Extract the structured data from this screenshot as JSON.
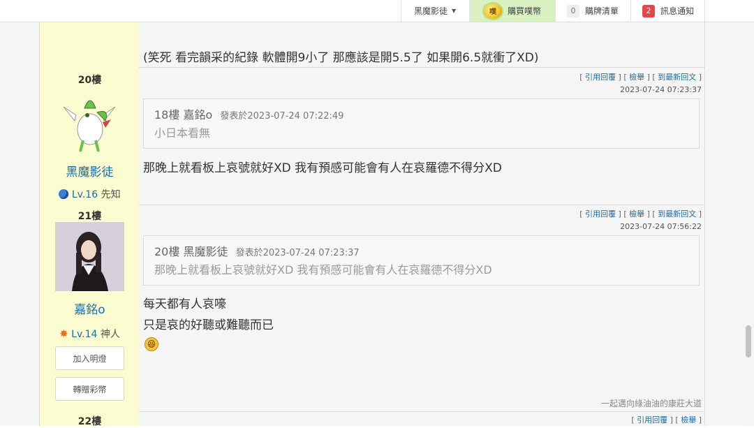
{
  "topbar": {
    "user_menu": "黑魔影徒",
    "buy_coins": "購買噗幣",
    "coin_icon_text": "噗",
    "cart_count": "0",
    "cart_label": "購牌清單",
    "notify_count": "2",
    "notify_label": "訊息通知"
  },
  "prev_post": {
    "text": "(笑死 看完韻采的紀錄 軟體開9小了 那應該是開5.5了 如果開6.5就衝了XD)"
  },
  "post20": {
    "floor": "20樓",
    "avatar_icon": "shaymin-sky-forme",
    "username": "黑魔影徒",
    "level": "Lv.16",
    "rank": "先知",
    "level_icon": "planet-icon",
    "actions": {
      "reply": "引用回覆",
      "report": "檢舉",
      "latest": "到最新回文"
    },
    "time": "2023-07-24 07:23:37",
    "quote": {
      "floor": "18樓",
      "user": "嘉銘o",
      "meta": "發表於2023-07-24 07:22:49",
      "body": "小日本看無"
    },
    "text": "那晚上就看板上哀號就好XD 我有預感可能會有人在哀羅德不得分XD"
  },
  "post21": {
    "floor": "21樓",
    "avatar_icon": "user-photo",
    "username": "嘉銘o",
    "level": "Lv.14",
    "rank": "神人",
    "level_icon": "star-burst-icon",
    "btn_follow": "加入明燈",
    "btn_gift": "轉贈彩幣",
    "actions": {
      "reply": "引用回覆",
      "report": "檢舉",
      "latest": "到最新回文"
    },
    "time": "2023-07-24 07:56:22",
    "quote": {
      "floor": "20樓",
      "user": "黑魔影徒",
      "meta": "發表於2023-07-24 07:23:37",
      "body": "那晚上就看板上哀號就好XD 我有預感可能會有人在哀羅德不得分XD"
    },
    "line1": "每天都有人哀嚎",
    "line2": "只是哀的好聽或難聽而已",
    "emoji_icon": "laughing-emoji",
    "signature": "一起邁向綠油油的康莊大道"
  },
  "post22": {
    "floor": "22樓",
    "actions": {
      "reply": "引用回覆",
      "report": "檢舉"
    }
  }
}
